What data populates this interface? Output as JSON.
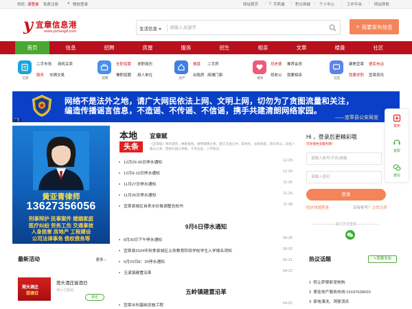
{
  "topbar": {
    "greeting": "你好，",
    "login": "请登录",
    "register": "免费注册",
    "wechat_login": "微信登录",
    "site_home": "网站首页",
    "mobile": "手机端",
    "follow": "积分商城",
    "personal": "个人中心",
    "workbench": "工作平台",
    "navigation": "网站导航"
  },
  "logo": {
    "mark": "y",
    "name": "宜章信息港",
    "url": "www.yizhang8.com"
  },
  "search": {
    "category": "生活信息",
    "placeholder": "请输入关键字"
  },
  "post_button": {
    "icon": "+",
    "label": "我要发布信息"
  },
  "nav": [
    "首页",
    "信息",
    "招聘",
    "房屋",
    "服务",
    "招生",
    "相亲",
    "文章",
    "楼盘",
    "社区"
  ],
  "services": [
    {
      "name": "信息",
      "color": "#19a5dc",
      "icon": "info-icon",
      "links": [
        [
          "二手市场",
          "商机买卖"
        ],
        [
          "服务",
          "车辆交易"
        ]
      ]
    },
    {
      "name": "招聘",
      "color": "#4b8fe8",
      "icon": "job-icon",
      "links": [
        [
          "全职招聘",
          "求职简历"
        ],
        [
          "兼职招聘",
          "用人单位"
        ]
      ]
    },
    {
      "name": "房产",
      "color": "#3f7fe0",
      "icon": "house-icon",
      "links": [
        [
          "楼盘",
          "二手房"
        ],
        [
          "出租房",
          "商铺门面"
        ]
      ]
    },
    {
      "name": "相亲",
      "color": "#f05a7a",
      "icon": "heart-icon",
      "links": [
        [
          "找老婆",
          "推荐会员"
        ],
        [
          "找老公",
          "我要相亲"
        ]
      ]
    },
    {
      "name": "社区",
      "color": "#5b84e6",
      "icon": "chat-icon",
      "links": [
        [
          "聚焦宜章",
          "便民电话"
        ],
        [
          "我要求职",
          "宜章资讯"
        ]
      ]
    }
  ],
  "banner": {
    "line1": "网络不是法外之地，请广大网民依法上网、文明上网，切勿为了贪图流量和关注，",
    "line2": "编造传播谣言信息，不造谣、不传谣、不信谣，携手共建清朗网络家园。",
    "signature": "——宜章县公安局宣",
    "ad_tag": "广告"
  },
  "lawyer_ad": {
    "name": "黄亚青律师",
    "phone": "13627356056",
    "services": "刑事辩护  民事案件  婚姻家庭\n医疗纠纷  劳务工伤  交通事故\n人身损害  房地产  工程建设\n公司法律事务  债权债务等"
  },
  "activity": {
    "title": "最新活动",
    "more": "更多",
    "item_title": "莞头酒庄尝酒日",
    "item_sub": "98人已报名",
    "item_button": "报名",
    "thumb_line1": "莞头酒庄",
    "thumb_line2": "尝酒日"
  },
  "headline": {
    "tag_line1": "本地",
    "tag_line2": "头条",
    "title": "宜章赋",
    "desc": "《宜章赋》南岭首府，郴南福地。湘粤锁钥之要，楚汉交通之冲。其地也，北枕骑田，南衍莽山，东揽八面山之翠，西接九嶷之余脉，千年古邑，人杰地灵。"
  },
  "news_top": [
    {
      "title": "12月29-30日停水通知",
      "date": "12-29"
    },
    {
      "title": "12月9-10日停水通知",
      "date": "12-09"
    },
    {
      "title": "11月27日停水通知",
      "date": "11-26"
    },
    {
      "title": "11月26日停水通知",
      "date": "11-25"
    },
    {
      "title": "宜章县城区自来水价格调整告知书",
      "date": "11-08"
    }
  ],
  "section2": {
    "title": "9月6日停水通知",
    "items": [
      {
        "title": "8月30日下午停水通知",
        "date": "08-30"
      },
      {
        "title": "宜章县2024年秋季县城区义务教育阶段学校学生入学报名须知",
        "date": "08-03"
      },
      {
        "title": "5月22日8：30停水通知",
        "date": "05-21"
      },
      {
        "title": "玉溪镇建置沿革",
        "date": "04-22"
      }
    ]
  },
  "section3": {
    "title": "五岭镇建置沿革",
    "items": [
      {
        "title": "宜章水利基础设施工程",
        "date": "04-02"
      }
    ]
  },
  "login": {
    "greeting": "Hi ，登录后更精彩哦",
    "sub": "可享受更多服务哦！",
    "username_placeholder": "请输入帐号/手机/邮箱",
    "password_placeholder": "请输入密码",
    "button": "登录",
    "sms": "短信快捷登录",
    "no_account": "没有帐号？",
    "register": "立即注册",
    "other": "其它方式登录"
  },
  "hot": {
    "title": "热议话题",
    "publish": "我要发帖",
    "items": [
      {
        "rank": "1",
        "title": "转让萨摩耶宠物狗"
      },
      {
        "rank": "2",
        "title": "美佳地产服务热线:15197539020"
      },
      {
        "rank": "3",
        "title": "家电清洗、洞客消杀"
      }
    ]
  },
  "sidebar": {
    "post": "发布",
    "service": "客服",
    "wechat": "微信"
  },
  "colors": {
    "brand_red": "#b8101c",
    "active_green": "#4aa832",
    "accent_orange": "#f5845a",
    "banner_blue": "#0a40c8"
  }
}
